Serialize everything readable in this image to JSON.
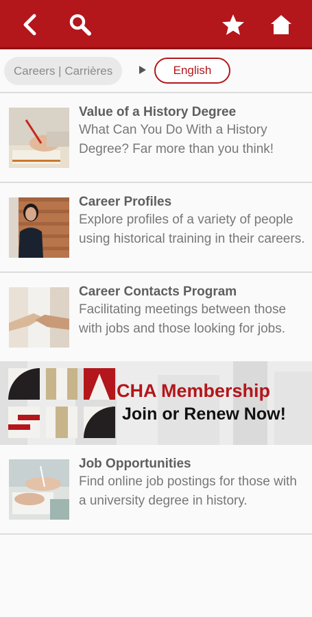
{
  "colors": {
    "brand": "#b3161b",
    "gold": "#c8b48a",
    "dark": "#231f20"
  },
  "topbar": {
    "icons": [
      "back-arrow-icon",
      "search-icon",
      "star-icon",
      "home-icon"
    ]
  },
  "breadcrumb": {
    "current": "Careers | Carrières",
    "language_button": "English"
  },
  "items": [
    {
      "title": "Value of a History Degree",
      "description": "What Can You Do With a History Degree? Far more than you think!"
    },
    {
      "title": "Career Profiles",
      "description": "Explore profiles of a variety of people using historical training in their careers."
    },
    {
      "title": "Career Contacts Program",
      "description": "Facilitating meetings between those with jobs and those looking for jobs."
    },
    {
      "title": "Job Opportunities",
      "description": "Find online job postings for those with a university degree in history."
    }
  ],
  "banner": {
    "line1": "CHA Membership",
    "line2": "Join or Renew Now!",
    "logo_letters": "CHA SHC"
  }
}
